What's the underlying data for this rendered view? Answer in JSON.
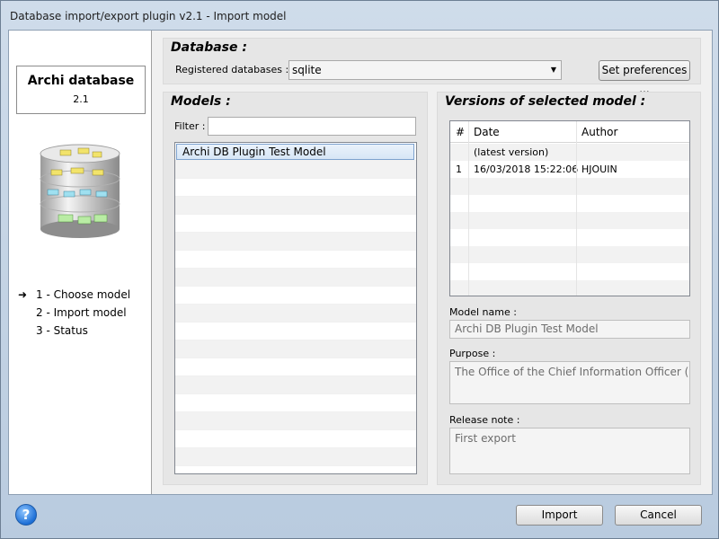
{
  "window": {
    "title": "Database import/export plugin v2.1 - Import model"
  },
  "left": {
    "db_name": "Archi database",
    "db_version": "2.1",
    "steps": [
      {
        "label": "1 - Choose model",
        "current": true
      },
      {
        "label": "2 - Import model",
        "current": false
      },
      {
        "label": "3 - Status",
        "current": false
      }
    ],
    "arrow_glyph": "➜"
  },
  "database": {
    "title": "Database :",
    "registered_label": "Registered databases :",
    "selected": "sqlite",
    "preferences_button": "Set preferences ..."
  },
  "models": {
    "title": "Models :",
    "filter_label": "Filter :",
    "filter_value": "",
    "items": [
      "Archi DB Plugin Test Model"
    ]
  },
  "versions": {
    "title": "Versions of selected model :",
    "columns": [
      "#",
      "Date",
      "Author"
    ],
    "rows": [
      {
        "num": "",
        "date": "(latest version)",
        "author": ""
      },
      {
        "num": "1",
        "date": "16/03/2018 15:22:06",
        "author": "HJOUIN"
      }
    ],
    "model_name_label": "Model name :",
    "model_name": "Archi DB Plugin Test Model",
    "purpose_label": "Purpose :",
    "purpose": "The Office of the Chief Information Officer (OCIO",
    "release_note_label": "Release note :",
    "release_note": "First export"
  },
  "footer": {
    "import_button": "Import",
    "cancel_button": "Cancel",
    "help_glyph": "?"
  },
  "colors": {
    "selection": "#d7e6f6",
    "selection_border": "#7da2ce",
    "chrome": "#c9d7e6"
  }
}
